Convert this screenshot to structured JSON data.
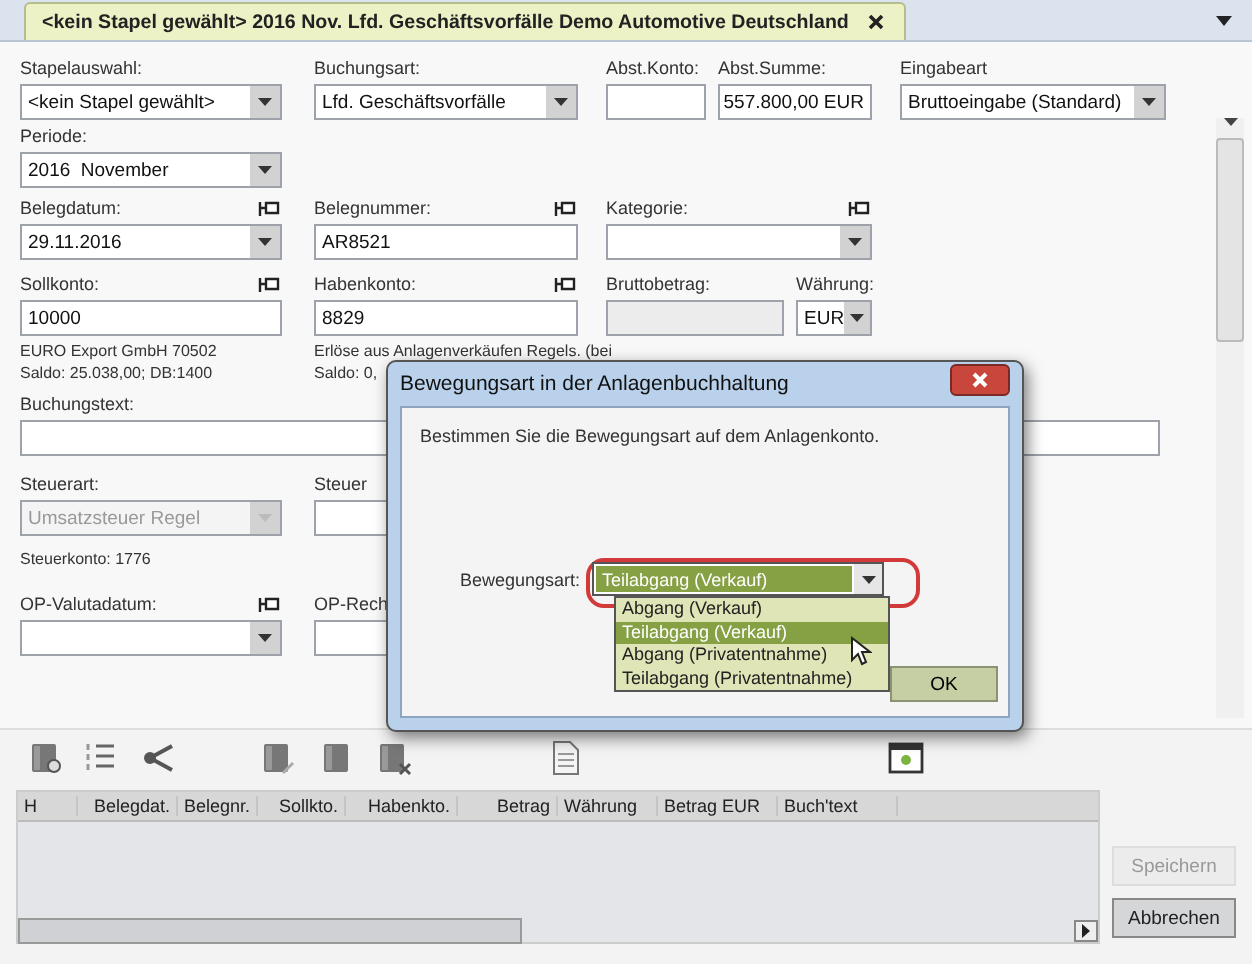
{
  "tab": {
    "title": "<kein Stapel gewählt> 2016 Nov. Lfd. Geschäftsvorfälle Demo Automotive Deutschland"
  },
  "form_rows": [
    {
      "fields": [
        {
          "label": "Stapelauswahl:",
          "kind": "combo",
          "value": "<kein Stapel gewählt>",
          "pinned": false,
          "disabled": false
        },
        {
          "label": "Buchungsart:",
          "kind": "combo",
          "value": "Lfd. Geschäftsvorfälle",
          "pinned": false,
          "disabled": false
        },
        {
          "label": "Abst.Konto:",
          "kind": "text",
          "pinned": false,
          "disabled": false
        },
        {
          "label": "Abst.Summe:",
          "kind": "amount",
          "value": "557.800,00 EUR",
          "pinned": false,
          "disabled": false
        },
        {
          "label": "Eingabeart",
          "kind": "combo",
          "value": "Bruttoeingabe (Standard)",
          "pinned": false,
          "disabled": false
        }
      ]
    },
    {
      "fields": [
        {
          "label": "Periode:",
          "kind": "combo",
          "value": "2016  November",
          "pinned": false,
          "disabled": false
        }
      ]
    },
    {
      "fields": [
        {
          "label": "Belegdatum:",
          "kind": "combo",
          "value": "29.11.2016",
          "pinned": true,
          "disabled": false
        },
        {
          "label": "Belegnummer:",
          "kind": "text",
          "value": "AR8521",
          "pinned": true,
          "disabled": false
        },
        {
          "label": "Kategorie:",
          "kind": "combo",
          "pinned": true,
          "disabled": false
        }
      ]
    },
    {
      "fields": [
        {
          "label": "Sollkonto:",
          "kind": "text",
          "value": "10000",
          "pinned": true,
          "disabled": false
        },
        {
          "label": "Habenkonto:",
          "kind": "text",
          "value": "8829",
          "pinned": true,
          "disabled": false
        },
        {
          "label": "Bruttobetrag:",
          "kind": "text",
          "pinned": false,
          "disabled": true
        },
        {
          "label": "Währung:",
          "kind": "combo",
          "value": "EUR",
          "pinned": false,
          "disabled": false
        }
      ]
    }
  ],
  "account_info": [
    {
      "name": "EURO Export GmbH 70502",
      "balance": "Saldo: 25.038,00; DB:1400"
    },
    {
      "name": "Erlöse aus Anlagenverkäufen Regels. (bei",
      "balance": "Saldo: 0,"
    }
  ],
  "booking_text": {
    "label": "Buchungstext:"
  },
  "tax_row": {
    "fields": [
      {
        "label": "Steuerart:",
        "kind": "combo",
        "value": "Umsatzsteuer Regel",
        "pinned": false,
        "disabled": true
      },
      {
        "label": "Steuer",
        "kind": "text",
        "pinned": false,
        "disabled": false
      }
    ]
  },
  "tax_account": "Steuerkonto: 1776",
  "op_row": {
    "fields": [
      {
        "label": "OP-Valutadatum:",
        "kind": "combo",
        "pinned": true,
        "disabled": false
      },
      {
        "label": "OP-Rech",
        "kind": "text",
        "pinned": false,
        "disabled": false
      }
    ]
  },
  "table": {
    "columns": [
      "H",
      "Belegdat.",
      "Belegnr.",
      "Sollkto.",
      "Habenkto.",
      "Betrag",
      "Währung",
      "Betrag EUR",
      "Buch'text"
    ]
  },
  "buttons": [
    {
      "label": "Speichern",
      "disabled": true
    },
    {
      "label": "Abbrechen",
      "disabled": false
    }
  ],
  "dialog": {
    "title": "Bewegungsart in der Anlagenbuchhaltung",
    "message": "Bestimmen Sie die Bewegungsart auf dem Anlagenkonto.",
    "field_label": "Bewegungsart:",
    "value": "Teilabgang (Verkauf)",
    "expanded": true,
    "options": [
      {
        "label": "Abgang (Verkauf)",
        "selected": false
      },
      {
        "label": "Teilabgang (Verkauf)",
        "selected": true
      },
      {
        "label": "Abgang (Privatentnahme)",
        "selected": false
      },
      {
        "label": "Teilabgang (Privatentnahme)",
        "selected": false
      }
    ],
    "ok": "OK"
  }
}
